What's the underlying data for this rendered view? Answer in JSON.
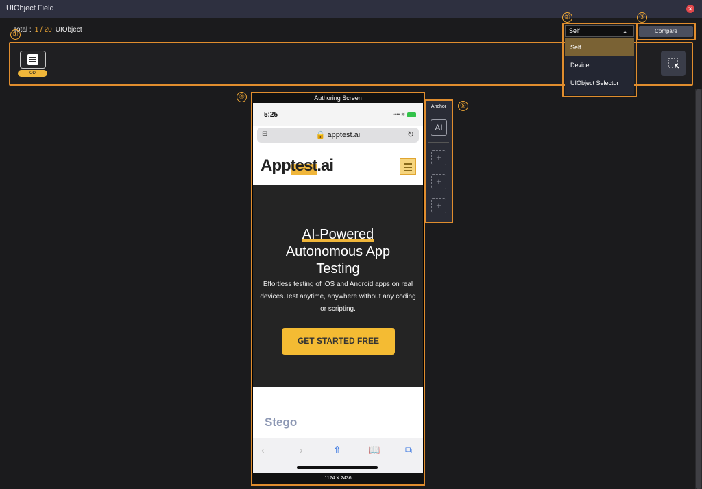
{
  "window": {
    "title": "UIObject Field",
    "close_icon": "close-icon"
  },
  "header": {
    "total_label": "Total :",
    "count": "1 / 20",
    "type": "UIObject"
  },
  "callouts": [
    "①",
    "②",
    "③",
    "④",
    "⑤"
  ],
  "strip": {
    "badge": "OD"
  },
  "dropdown": {
    "selected": "Self",
    "options": [
      "Self",
      "Device",
      "UIObject Selector"
    ]
  },
  "compare": {
    "label": "Compare"
  },
  "phone": {
    "label": "Authoring Screen",
    "resolution": "1124 X 2436",
    "time": "5:25",
    "url": "apptest.ai",
    "logo_a": "App",
    "logo_b": "test",
    "logo_c": ".ai",
    "hero_title_1": "AI-Powered",
    "hero_title_2": "Autonomous App",
    "hero_title_3": "Testing",
    "hero_text": "Effortless testing of iOS and Android apps on real devices.Test anytime, anywhere without any coding or scripting.",
    "cta": "GET STARTED FREE",
    "stego": "Stego"
  },
  "anchor": {
    "label": "Anchor",
    "ai": "AI",
    "slot_glyph": "+"
  },
  "colors": {
    "accent": "#e08d2e",
    "badge": "#f0b63a",
    "close": "#e2474b"
  }
}
